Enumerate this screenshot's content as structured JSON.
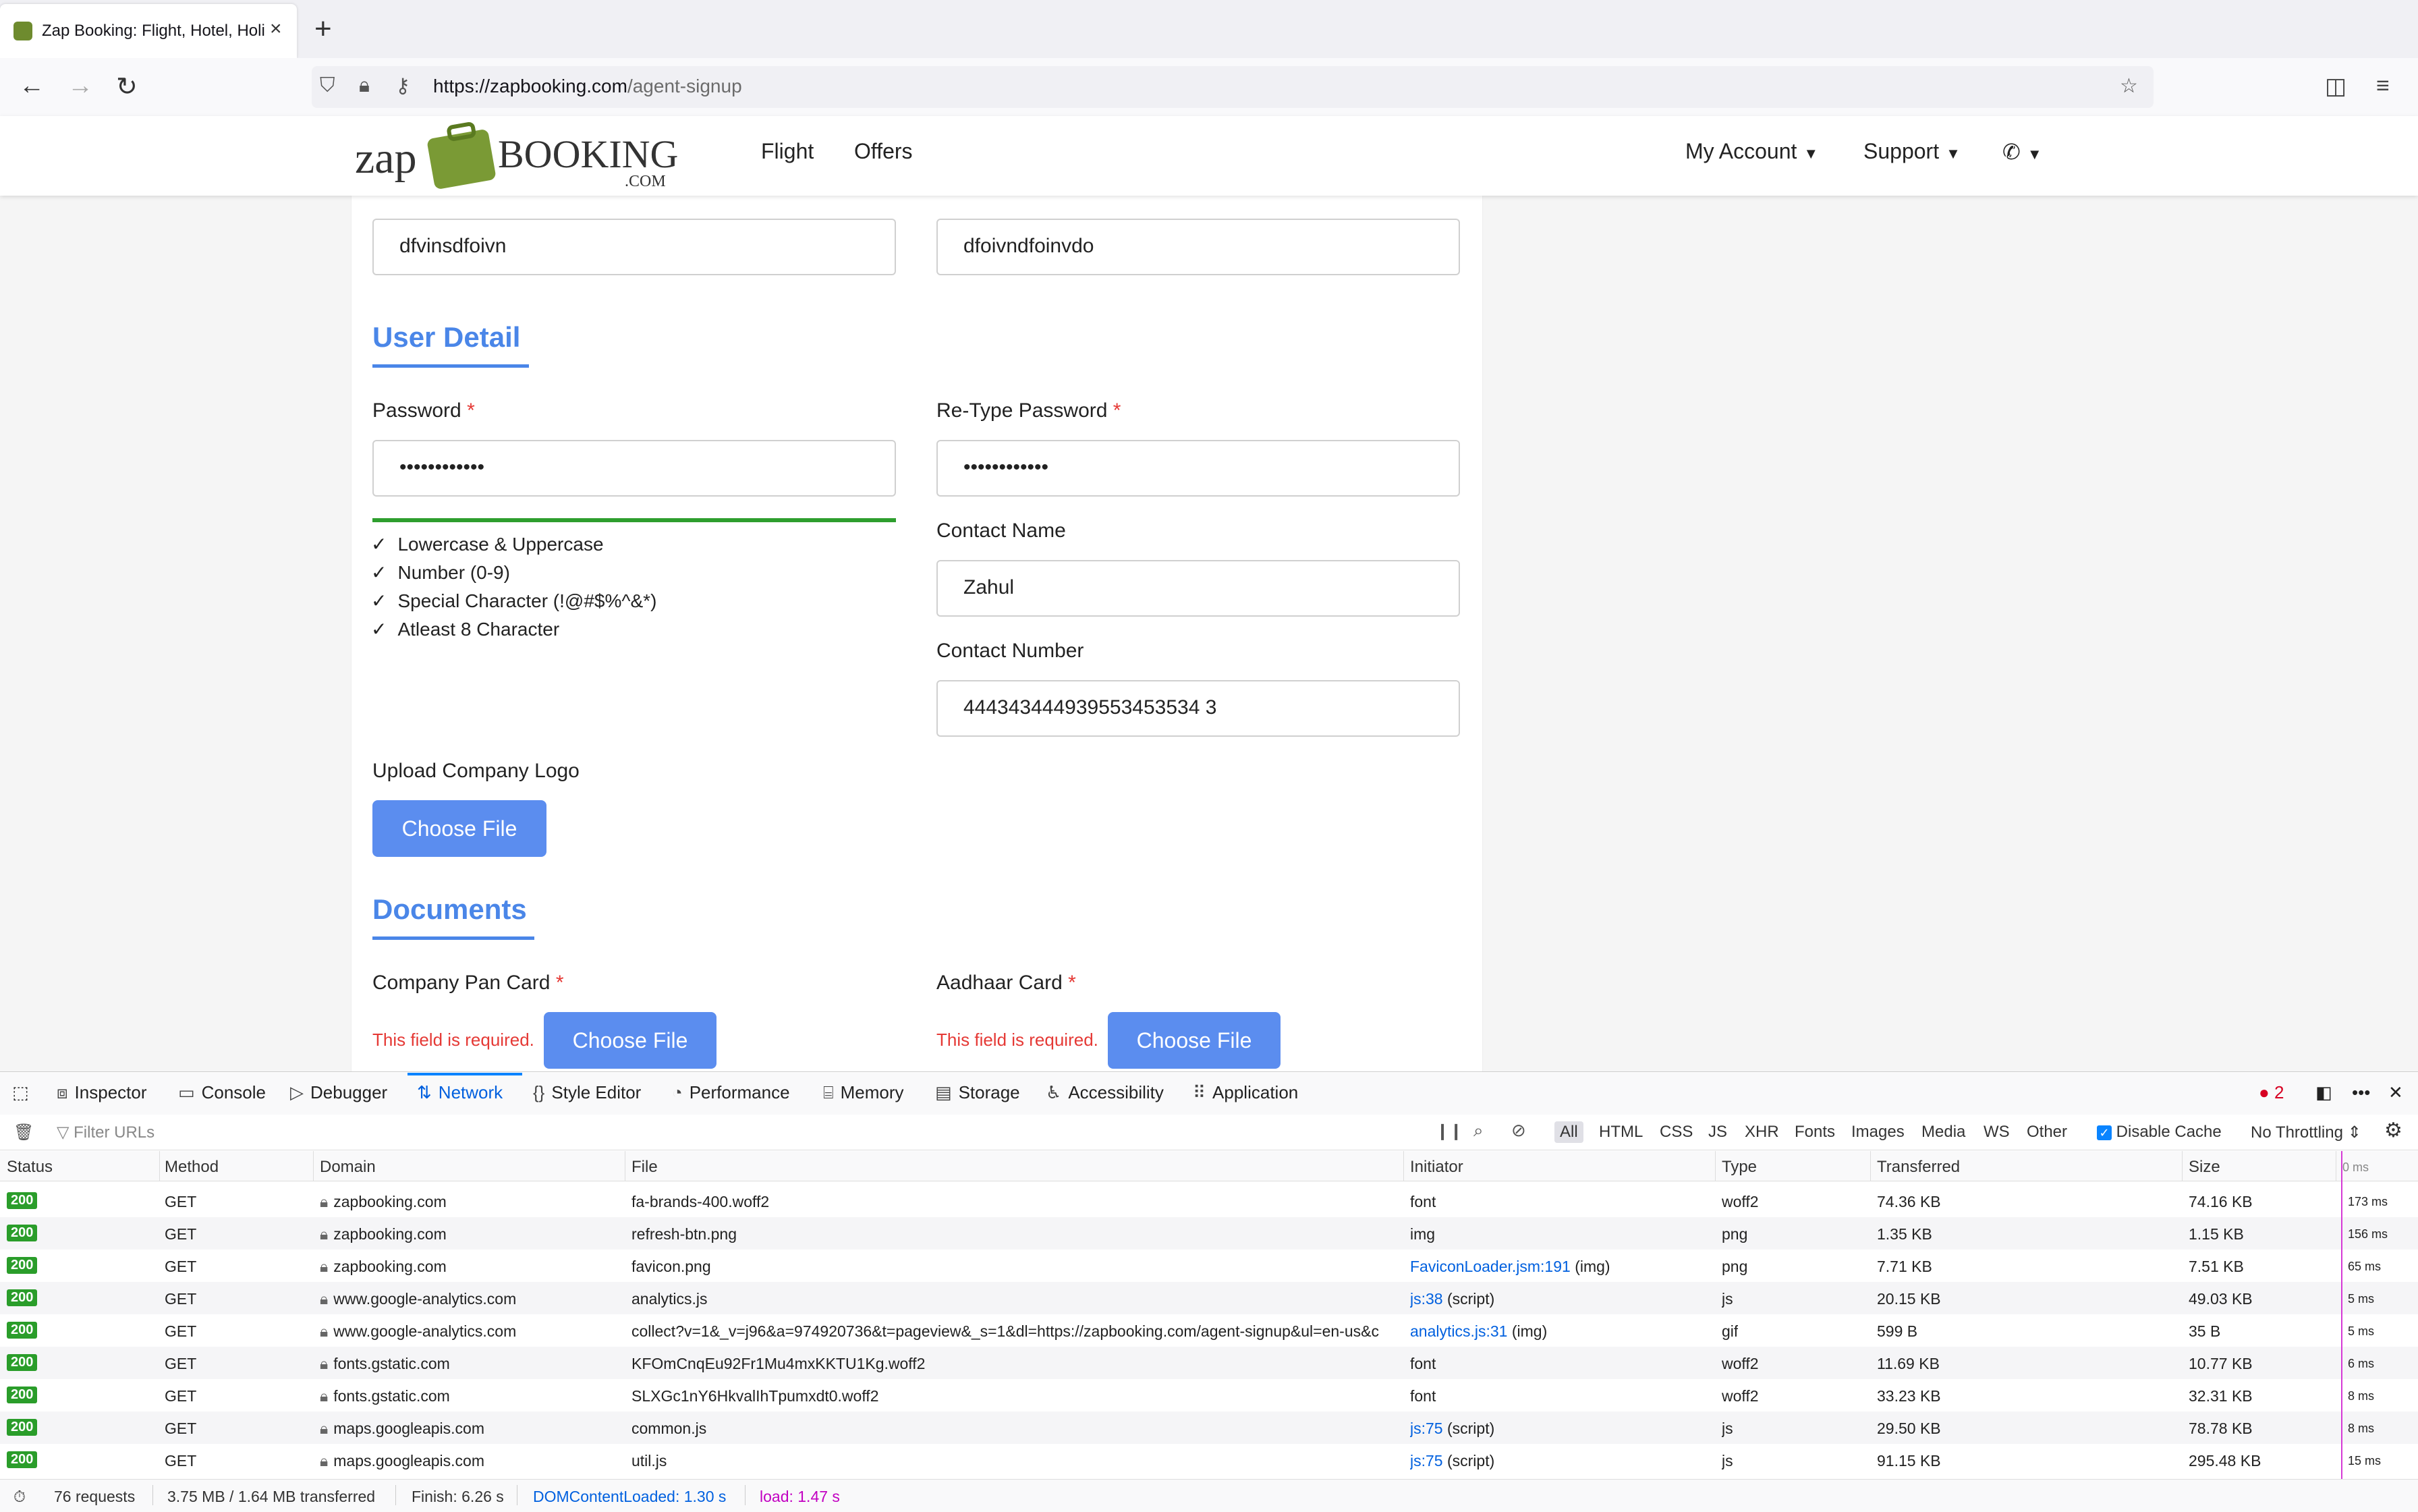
{
  "browser": {
    "tab_title": "Zap Booking: Flight, Hotel, Holid",
    "url_host": "https://zapbooking.com",
    "url_path": "/agent-signup"
  },
  "site": {
    "logo_text_left": "zap",
    "logo_text_right": "BOOKING",
    "logo_suffix": ".COM",
    "nav": [
      "Flight",
      "Offers"
    ],
    "right_nav": [
      "My Account",
      "Support"
    ]
  },
  "form": {
    "top_fields": [
      "dfvinsdfoivn",
      "dfoivndfoinvdo"
    ],
    "user_detail_title": "User Detail",
    "password_label": "Password",
    "retype_label": "Re-Type Password",
    "password_value": "••••••••••••",
    "retype_value": "••••••••••••",
    "checks": [
      "Lowercase & Uppercase",
      "Number (0-9)",
      "Special Character (!@#$%^&*)",
      "Atleast 8 Character"
    ],
    "contact_name_label": "Contact Name",
    "contact_name_value": "Zahul",
    "contact_number_label": "Contact Number",
    "contact_number_value": "444343444939553453534 3",
    "upload_logo_label": "Upload Company Logo",
    "choose_file": "Choose File",
    "documents_title": "Documents",
    "pan_label": "Company Pan Card",
    "aadhaar_label": "Aadhaar Card",
    "error_text": "This field is required."
  },
  "devtools": {
    "tabs": [
      "Inspector",
      "Console",
      "Debugger",
      "Network",
      "Style Editor",
      "Performance",
      "Memory",
      "Storage",
      "Accessibility",
      "Application"
    ],
    "error_count": "2",
    "filter_placeholder": "Filter URLs",
    "type_filters": [
      "All",
      "HTML",
      "CSS",
      "JS",
      "XHR",
      "Fonts",
      "Images",
      "Media",
      "WS",
      "Other"
    ],
    "disable_cache": "Disable Cache",
    "throttling": "No Throttling",
    "columns": [
      "Status",
      "Method",
      "Domain",
      "File",
      "Initiator",
      "Type",
      "Transferred",
      "Size",
      "0 ms"
    ],
    "rows": [
      {
        "status": "200",
        "method": "GET",
        "domain": "zapbooking.com",
        "file": "fa-brands-400.woff2",
        "initiator": "font",
        "initiator_link": "",
        "type": "woff2",
        "transferred": "74.36 KB",
        "size": "74.16 KB",
        "time": "173 ms"
      },
      {
        "status": "200",
        "method": "GET",
        "domain": "zapbooking.com",
        "file": "refresh-btn.png",
        "initiator": "img",
        "initiator_link": "",
        "type": "png",
        "transferred": "1.35 KB",
        "size": "1.15 KB",
        "time": "156 ms"
      },
      {
        "status": "200",
        "method": "GET",
        "domain": "zapbooking.com",
        "file": "favicon.png",
        "initiator": " (img)",
        "initiator_link": "FaviconLoader.jsm:191",
        "type": "png",
        "transferred": "7.71 KB",
        "size": "7.51 KB",
        "time": "65 ms"
      },
      {
        "status": "200",
        "method": "GET",
        "domain": "www.google-analytics.com",
        "file": "analytics.js",
        "initiator": " (script)",
        "initiator_link": "js:38",
        "type": "js",
        "transferred": "20.15 KB",
        "size": "49.03 KB",
        "time": "5 ms"
      },
      {
        "status": "200",
        "method": "GET",
        "domain": "www.google-analytics.com",
        "file": "collect?v=1&_v=j96&a=974920736&t=pageview&_s=1&dl=https://zapbooking.com/agent-signup&ul=en-us&c",
        "initiator": " (img)",
        "initiator_link": "analytics.js:31",
        "type": "gif",
        "transferred": "599 B",
        "size": "35 B",
        "time": "5 ms"
      },
      {
        "status": "200",
        "method": "GET",
        "domain": "fonts.gstatic.com",
        "file": "KFOmCnqEu92Fr1Mu4mxKKTU1Kg.woff2",
        "initiator": "font",
        "initiator_link": "",
        "type": "woff2",
        "transferred": "11.69 KB",
        "size": "10.77 KB",
        "time": "6 ms"
      },
      {
        "status": "200",
        "method": "GET",
        "domain": "fonts.gstatic.com",
        "file": "SLXGc1nY6HkvalIhTpumxdt0.woff2",
        "initiator": "font",
        "initiator_link": "",
        "type": "woff2",
        "transferred": "33.23 KB",
        "size": "32.31 KB",
        "time": "8 ms"
      },
      {
        "status": "200",
        "method": "GET",
        "domain": "maps.googleapis.com",
        "file": "common.js",
        "initiator": " (script)",
        "initiator_link": "js:75",
        "type": "js",
        "transferred": "29.50 KB",
        "size": "78.78 KB",
        "time": "8 ms"
      },
      {
        "status": "200",
        "method": "GET",
        "domain": "maps.googleapis.com",
        "file": "util.js",
        "initiator": " (script)",
        "initiator_link": "js:75",
        "type": "js",
        "transferred": "91.15 KB",
        "size": "295.48 KB",
        "time": "15 ms"
      }
    ],
    "summary": {
      "requests": "76 requests",
      "transferred": "3.75 MB / 1.64 MB transferred",
      "finish": "Finish: 6.26 s",
      "dcl": "DOMContentLoaded: 1.30 s",
      "load": "load: 1.47 s"
    }
  }
}
